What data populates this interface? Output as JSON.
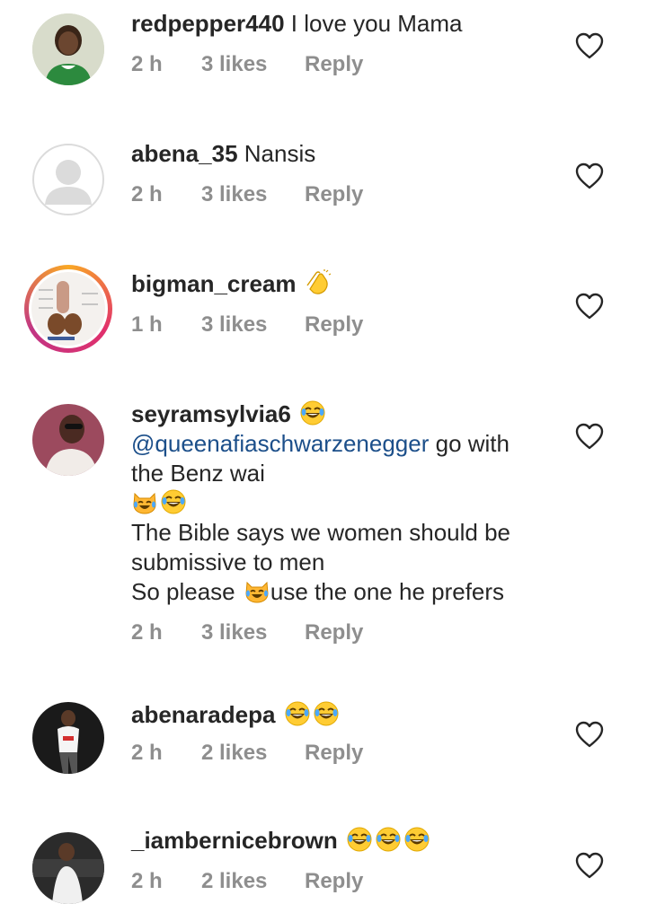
{
  "comments": [
    {
      "user": "redpepper440",
      "text": "I love you Mama",
      "time": "2 h",
      "likes": "3 likes",
      "reply": "Reply"
    },
    {
      "user": "abena_35",
      "text": "Nansis",
      "time": "2 h",
      "likes": "3 likes",
      "reply": "Reply"
    },
    {
      "user": "bigman_cream",
      "text": "",
      "time": "1 h",
      "likes": "3 likes",
      "reply": "Reply"
    },
    {
      "user": "seyramsylvia6",
      "mention": "@queenafiaschwarzenegger",
      "line1_rest": " go with",
      "line2": "the Benz wai",
      "line4": "The Bible says we women should be",
      "line5": "submissive to men",
      "line6a": "So please ",
      "line6b": "use the one he prefers",
      "time": "2 h",
      "likes": "3 likes",
      "reply": "Reply"
    },
    {
      "user": "abenaradepa",
      "text": "",
      "time": "2 h",
      "likes": "2 likes",
      "reply": "Reply"
    },
    {
      "user": "_iambernicebrown",
      "text": "",
      "time": "2 h",
      "likes": "2 likes",
      "reply": "Reply"
    }
  ],
  "icons": {
    "heart": "heart-outline-icon",
    "laugh": "tears-of-joy-emoji",
    "cat": "cat-tears-of-joy-emoji",
    "clap": "clapping-hands-emoji"
  },
  "colors": {
    "text": "#262626",
    "meta": "#8e8e8e",
    "mention": "#1c4f8a"
  }
}
